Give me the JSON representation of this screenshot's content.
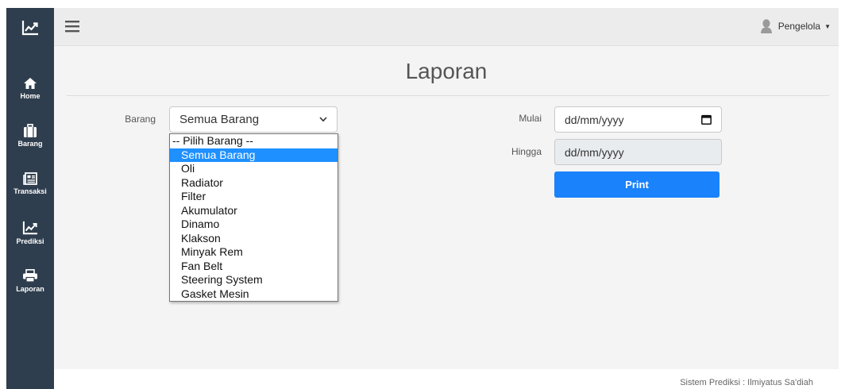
{
  "sidebar": {
    "brand_icon": "chart-line-icon",
    "items": [
      {
        "label": "Home",
        "icon": "home-icon"
      },
      {
        "label": "Barang",
        "icon": "briefcase-icon"
      },
      {
        "label": "Transaksi",
        "icon": "newspaper-icon"
      },
      {
        "label": "Prediksi",
        "icon": "chart-line-icon"
      },
      {
        "label": "Laporan",
        "icon": "print-icon"
      }
    ]
  },
  "topbar": {
    "user_name": "Pengelola",
    "menu_icon": "bars-icon",
    "avatar_icon": "user-icon"
  },
  "page": {
    "title": "Laporan"
  },
  "form": {
    "barang_label": "Barang",
    "barang_selected": "Semua Barang",
    "options": [
      "-- Pilih Barang --",
      "Semua Barang",
      "Oli",
      "Radiator",
      "Filter",
      "Akumulator",
      "Dinamo",
      "Klakson",
      "Minyak Rem",
      "Fan Belt",
      "Steering System",
      "Gasket Mesin"
    ],
    "mulai_label": "Mulai",
    "mulai_value": "dd/mm/yyyy",
    "hingga_label": "Hingga",
    "hingga_value": "dd/mm/yyyy",
    "print_label": "Print"
  },
  "footer": {
    "text": "Sistem Prediksi : Ilmiyatus Sa'diah"
  },
  "colors": {
    "sidebar": "#2f3e4e",
    "accent": "#1a82fb",
    "selected_option": "#1e90ff"
  }
}
